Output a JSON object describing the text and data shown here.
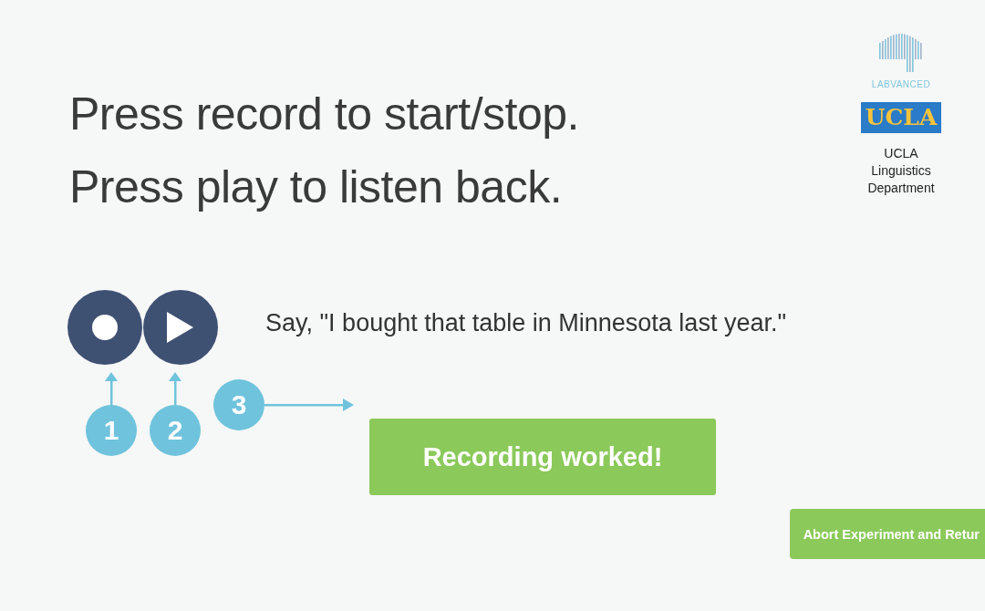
{
  "instructions": [
    "Press record to start/stop.",
    "Press play to listen back."
  ],
  "logos": {
    "labvanced": "LABVANCED",
    "ucla": "UCLA",
    "department": "UCLA Linguistics Department"
  },
  "controls": [
    {
      "kind": "record"
    },
    {
      "kind": "play"
    }
  ],
  "prompt": "Say, \"I bought that table in Minnesota last year.\"",
  "steps": [
    {
      "number": "1",
      "kind": "up"
    },
    {
      "number": "2",
      "kind": "up"
    },
    {
      "number": "3",
      "kind": "right"
    }
  ],
  "status_button": "Recording worked!",
  "abort_button": "Abort Experiment and Retur"
}
